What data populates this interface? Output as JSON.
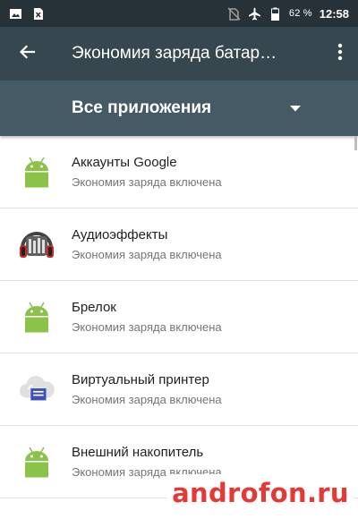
{
  "status_bar": {
    "battery_percent": "62 %",
    "time": "12:58",
    "icons": [
      "image-icon",
      "sim-icon",
      "no-sim-icon",
      "airplane-icon",
      "battery-icon"
    ]
  },
  "app_bar": {
    "title": "Экономия заряда батар…",
    "back_icon": "back-arrow-icon",
    "menu_icon": "more-vert-icon"
  },
  "filter": {
    "selected": "Все приложения",
    "icon": "dropdown-arrow-icon"
  },
  "apps": [
    {
      "name": "Аккаунты Google",
      "status": "Экономия заряда включена",
      "icon": "android-icon"
    },
    {
      "name": "Аудиоэффекты",
      "status": "Экономия заряда включена",
      "icon": "headphones-icon"
    },
    {
      "name": "Брелок",
      "status": "Экономия заряда включена",
      "icon": "android-icon"
    },
    {
      "name": "Виртуальный принтер",
      "status": "Экономия заряда включена",
      "icon": "cloud-print-icon"
    },
    {
      "name": "Внешний накопитель",
      "status": "Экономия заряда включена",
      "icon": "android-icon"
    }
  ],
  "watermark": "androfon.ru",
  "colors": {
    "status_bar": "#263238",
    "app_bar": "#37474f",
    "filter_bar": "#455a64",
    "android_green": "#8bc34a",
    "watermark": "#e53935"
  }
}
